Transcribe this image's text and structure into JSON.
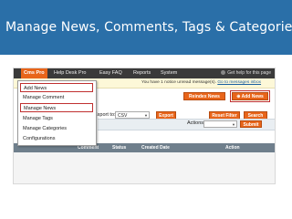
{
  "slide": {
    "title": "Manage News, Comments, Tags & Categories"
  },
  "topnav": {
    "items": [
      {
        "label": "Cms Pro"
      },
      {
        "label": "Help Desk Pro"
      },
      {
        "label": "Easy FAQ"
      },
      {
        "label": "Reports"
      },
      {
        "label": "System"
      }
    ],
    "help": "Get help for this page"
  },
  "notice": {
    "text": "You have 1 notice unread message(s).",
    "link": "Go to messages inbox"
  },
  "dropdown": {
    "items": [
      {
        "label": "Add News"
      },
      {
        "label": "Manage Comment"
      },
      {
        "label": "Manage News"
      },
      {
        "label": "Manage Tags"
      },
      {
        "label": "Manage Categories"
      },
      {
        "label": "Configurations"
      }
    ]
  },
  "actions": {
    "reindex_label": "Reindex News",
    "add_news_label": "Add News"
  },
  "export_bar": {
    "label": "Export to:",
    "format": "CSV",
    "export_label": "Export",
    "reset_label": "Reset Filter",
    "search_label": "Search"
  },
  "massaction": {
    "label": "Actions",
    "submit_label": "Submit"
  },
  "table": {
    "headers": [
      "Comment",
      "Status",
      "Created Date",
      "Action"
    ]
  },
  "colors": {
    "title_bar": "#2a6fa8",
    "nav_bg": "#3a3a3a",
    "accent": "#e8651a",
    "highlight": "#c03030"
  }
}
